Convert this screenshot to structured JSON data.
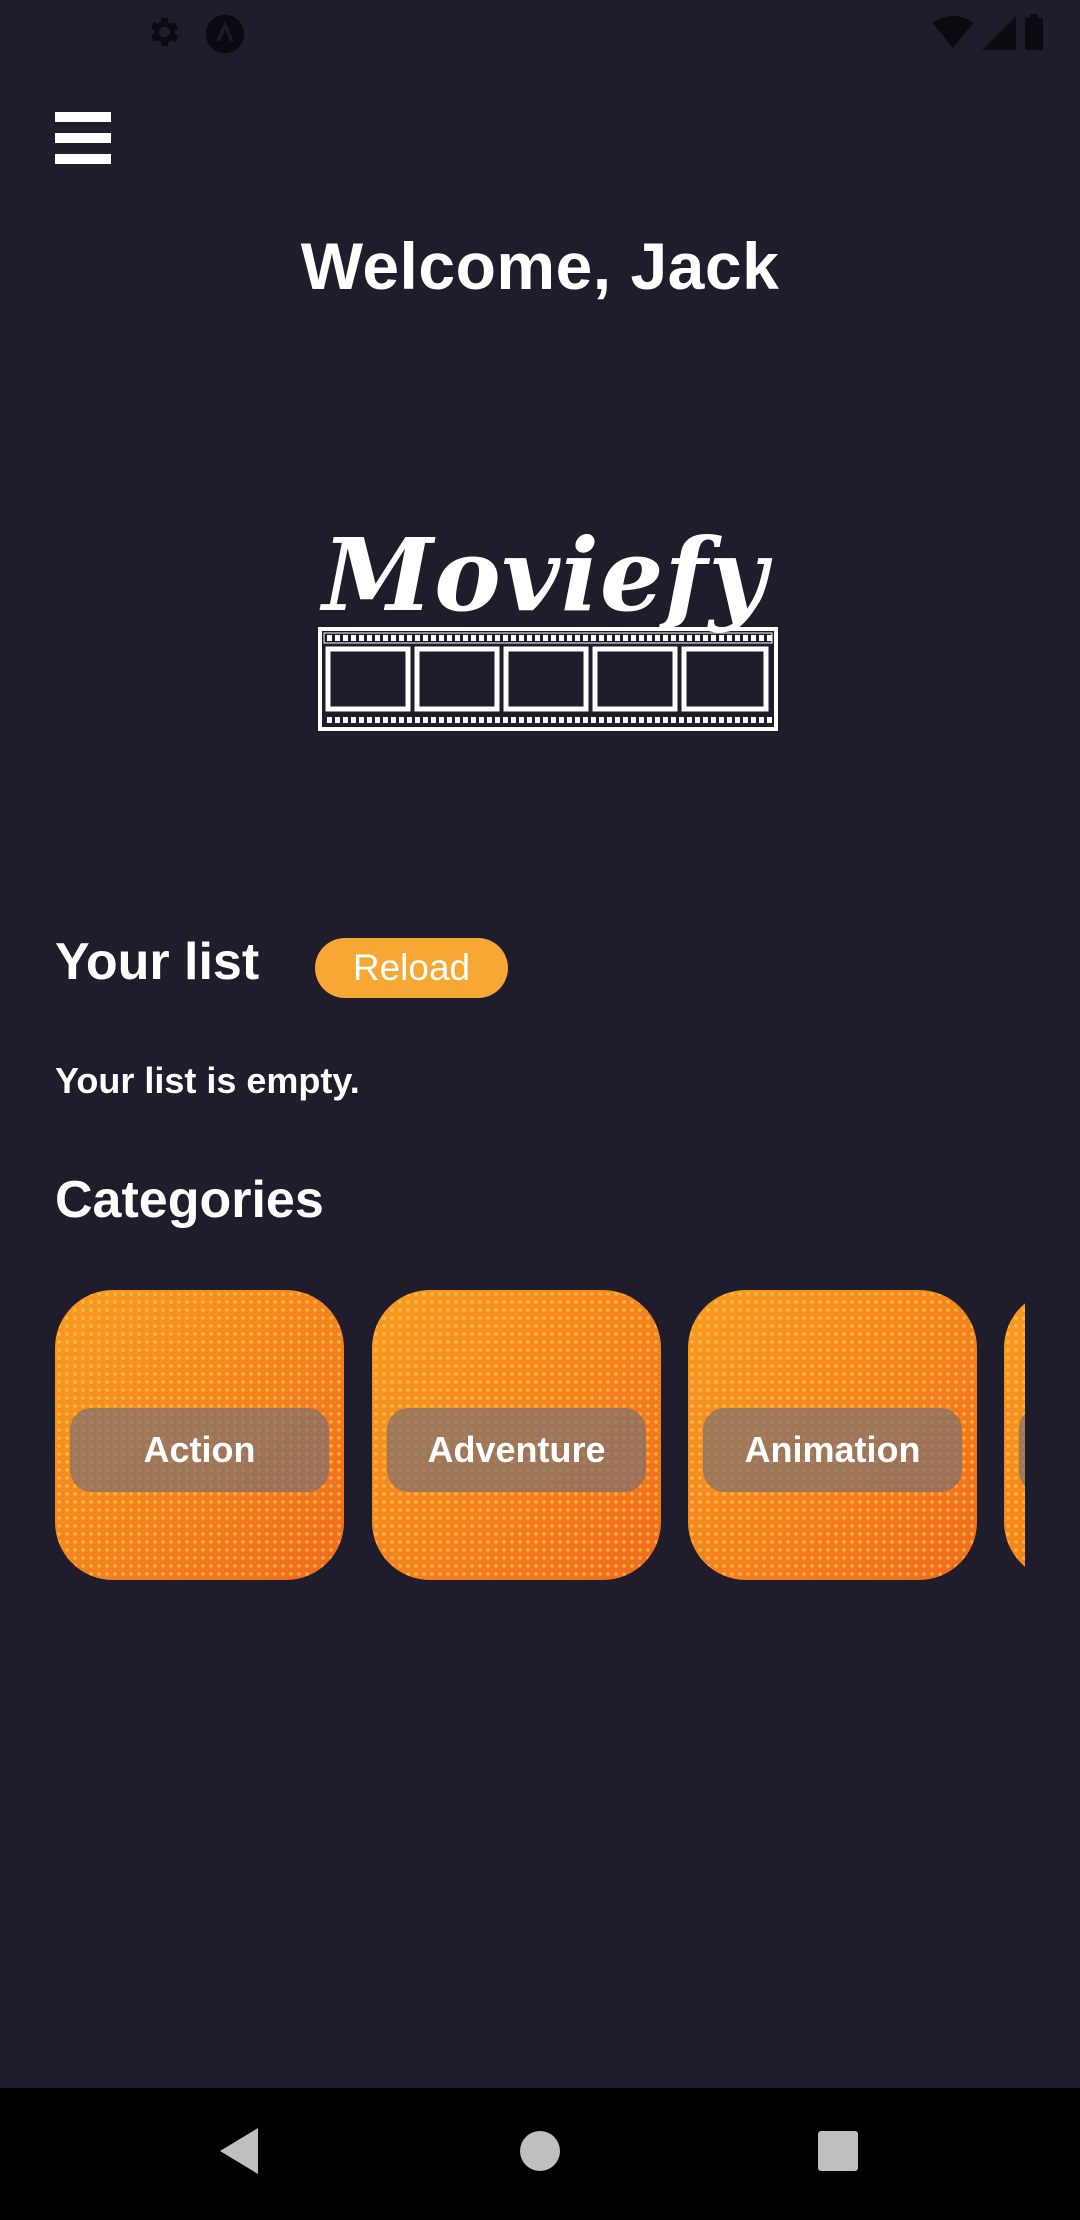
{
  "status_bar": {
    "left_icons": [
      "settings-icon",
      "app-notification-icon"
    ],
    "right_icons": [
      "wifi-icon",
      "signal-icon",
      "battery-icon"
    ]
  },
  "header": {
    "menu_icon": "hamburger-menu-icon",
    "welcome": "Welcome, Jack"
  },
  "logo": {
    "text": "Moviefy"
  },
  "your_list": {
    "title": "Your list",
    "reload_label": "Reload",
    "empty_text": "Your list is empty."
  },
  "categories": {
    "title": "Categories",
    "items": [
      {
        "label": "Action"
      },
      {
        "label": "Adventure"
      },
      {
        "label": "Animation"
      },
      {
        "label": ""
      }
    ]
  },
  "nav_bar": {
    "back": "back-icon",
    "home": "home-icon",
    "recents": "recents-icon"
  },
  "colors": {
    "background": "#1f1c2b",
    "accent": "#f7a733",
    "card_orange": "#f47c1e"
  }
}
